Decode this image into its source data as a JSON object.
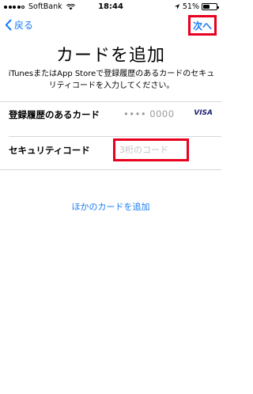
{
  "status_bar": {
    "carrier": "SoftBank",
    "time": "18:44",
    "battery_percent": "51%",
    "battery_level": 0.51
  },
  "nav": {
    "back_label": "戻る",
    "next_label": "次へ"
  },
  "page": {
    "title": "カードを追加",
    "description": "iTunesまたはApp Storeで登録履歴のあるカードのセキュリティコードを入力してください。"
  },
  "card_row": {
    "label": "登録履歴のあるカード",
    "masked_number": "•••• 0000",
    "brand": "VISA"
  },
  "security_row": {
    "label": "セキュリティコード",
    "value": "",
    "placeholder": "3桁のコード"
  },
  "add_other_card": "ほかのカードを追加",
  "colors": {
    "accent": "#1a7cf5",
    "highlight": "#e8001e",
    "divider": "#d6d6da"
  }
}
